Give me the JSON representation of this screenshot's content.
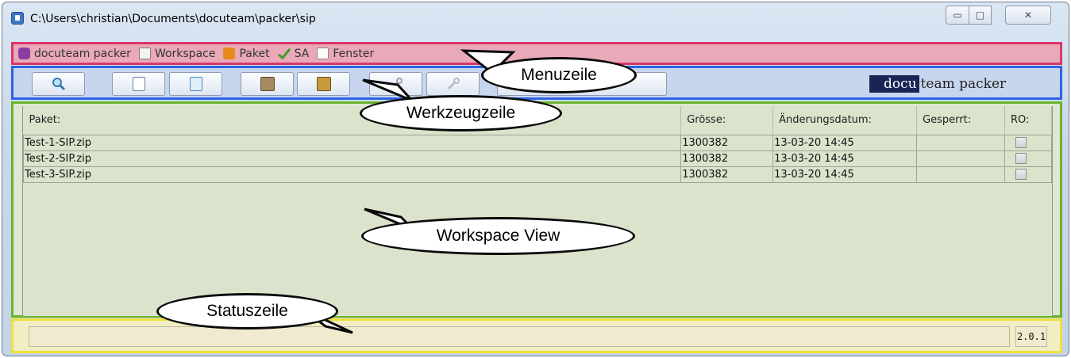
{
  "window": {
    "title": "C:\\Users\\christian\\Documents\\docuteam\\packer\\sip",
    "controls": {
      "minimize": "▭",
      "maximize": "□",
      "close": "✕"
    }
  },
  "menu": [
    {
      "label": "docuteam packer",
      "icon": "packer-icon"
    },
    {
      "label": "Workspace",
      "icon": "workspace-icon"
    },
    {
      "label": "Paket",
      "icon": "package-icon"
    },
    {
      "label": "SA",
      "icon": "checkmark-icon"
    },
    {
      "label": "Fenster",
      "icon": "window-list-icon"
    }
  ],
  "toolbar": {
    "buttons": [
      "search-icon",
      "new-document-icon",
      "open-document-icon",
      "edit-icon",
      "save-icon",
      "wrench-icon",
      "wrench-disabled-icon"
    ],
    "brand": {
      "highlight": "docu",
      "rest": "team packer"
    }
  },
  "table": {
    "headers": [
      "Paket:",
      "Grösse:",
      "Änderungsdatum:",
      "Gesperrt:",
      "RO:"
    ],
    "rows": [
      {
        "name": "Test-1-SIP.zip",
        "size": "1300382",
        "date": "13-03-20 14:45",
        "locked": "",
        "ro": false
      },
      {
        "name": "Test-2-SIP.zip",
        "size": "1300382",
        "date": "13-03-20 14:45",
        "locked": "",
        "ro": false
      },
      {
        "name": "Test-3-SIP.zip",
        "size": "1300382",
        "date": "13-03-20 14:45",
        "locked": "",
        "ro": false
      }
    ]
  },
  "status": {
    "text": "",
    "version": "2.0.1"
  },
  "callouts": {
    "menu": "Menuzeile",
    "toolbar": "Werkzeugzeile",
    "workspace": "Workspace View",
    "status": "Statuszeile"
  },
  "colors": {
    "menu_highlight": "#d9376a",
    "toolbar_highlight": "#2c64e2",
    "workspace_highlight": "#6bb32a",
    "status_highlight": "#ede23a"
  }
}
